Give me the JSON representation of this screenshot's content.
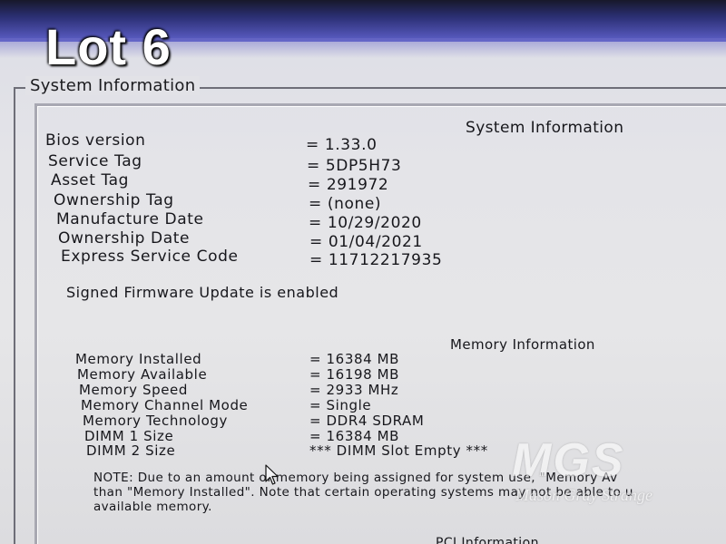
{
  "overlay": {
    "lot_label": "Lot 6"
  },
  "page": {
    "outer_title": "System Information"
  },
  "system_information": {
    "heading": "System Information",
    "rows": [
      {
        "label": "Bios version",
        "value": "= 1.33.0"
      },
      {
        "label": "Service Tag",
        "value": "= 5DP5H73"
      },
      {
        "label": "Asset Tag",
        "value": "= 291972"
      },
      {
        "label": "Ownership Tag",
        "value": "= (none)"
      },
      {
        "label": "Manufacture Date",
        "value": "= 10/29/2020"
      },
      {
        "label": "Ownership Date",
        "value": "= 01/04/2021"
      },
      {
        "label": "Express Service Code",
        "value": "= 11712217935"
      }
    ],
    "firmware_status": "Signed Firmware Update is enabled"
  },
  "memory_information": {
    "heading": "Memory Information",
    "rows": [
      {
        "label": "Memory Installed",
        "value": "= 16384 MB"
      },
      {
        "label": "Memory Available",
        "value": "= 16198 MB"
      },
      {
        "label": "Memory Speed",
        "value": "= 2933 MHz"
      },
      {
        "label": "Memory Channel Mode",
        "value": "= Single"
      },
      {
        "label": "Memory Technology",
        "value": "= DDR4 SDRAM"
      },
      {
        "label": "DIMM 1 Size",
        "value": "= 16384 MB"
      },
      {
        "label": "DIMM 2 Size",
        "value": "*** DIMM Slot Empty ***"
      }
    ],
    "note_lines": [
      "NOTE: Due to an amount of memory being assigned for system use, \"Memory Av",
      "than \"Memory Installed\". Note that certain operating systems may not be able to u",
      "available memory."
    ]
  },
  "pci_information": {
    "heading": "PCI Information"
  },
  "watermark": {
    "logo": "MGS",
    "name": "Mason Gray Strange"
  },
  "icons": {
    "cursor": "mouse-pointer-icon"
  },
  "colors": {
    "screen_bg": "#e4e4e8",
    "text": "#17171c",
    "band": "#5d5fc8"
  }
}
